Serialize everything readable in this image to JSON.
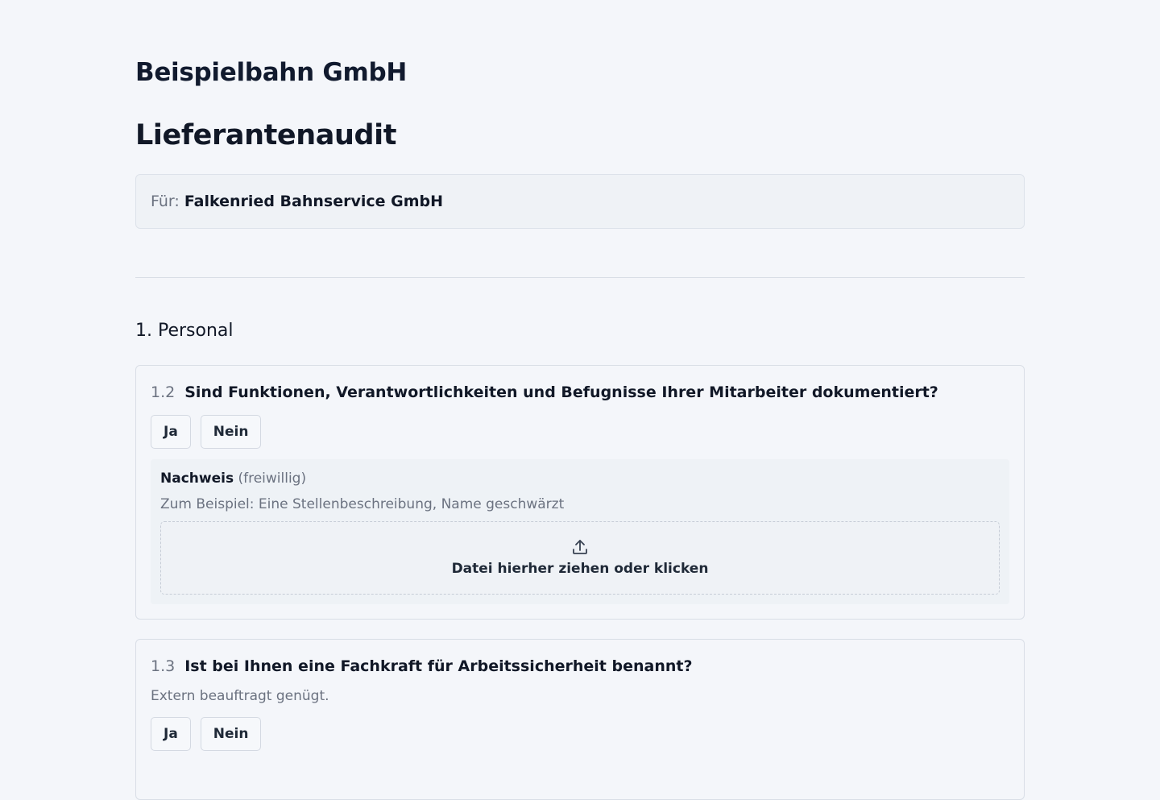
{
  "header": {
    "company": "Beispielbahn GmbH",
    "title": "Lieferantenaudit"
  },
  "recipient": {
    "label": "Für:",
    "name": "Falkenried Bahnservice GmbH"
  },
  "sections": [
    {
      "title": "1. Personal",
      "questions": [
        {
          "number": "1.2",
          "text": "Sind Funktionen, Verantwortlichkeiten und Befugnisse Ihrer Mitarbeiter dokumentiert?",
          "yes_label": "Ja",
          "no_label": "Nein",
          "evidence": {
            "title": "Nachweis",
            "optional": "(freiwillig)",
            "hint": "Zum Beispiel: Eine Stellenbeschreibung, Name geschwärzt",
            "dropzone_label": "Datei hierher ziehen oder klicken",
            "icon": "upload-icon"
          }
        },
        {
          "number": "1.3",
          "text": "Ist bei Ihnen eine Fachkraft für Arbeitssicherheit benannt?",
          "hint": "Extern beauftragt genügt.",
          "yes_label": "Ja",
          "no_label": "Nein"
        }
      ]
    }
  ]
}
